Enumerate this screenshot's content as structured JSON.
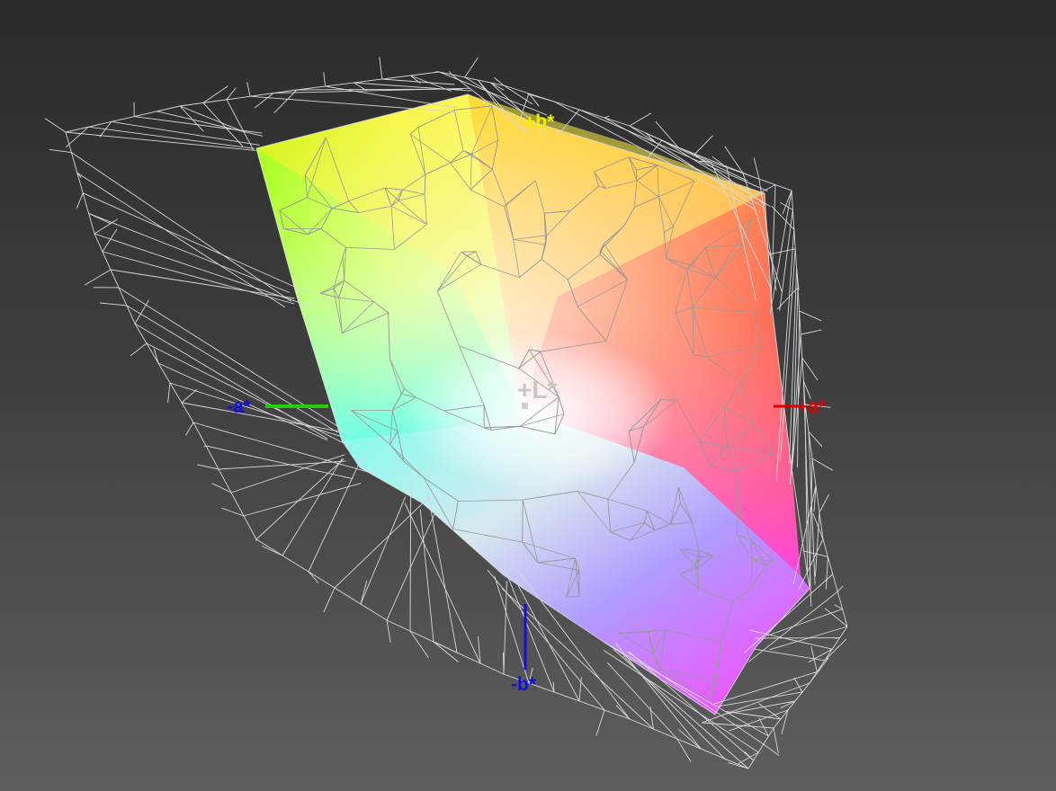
{
  "axes": {
    "plus_l": "+L*",
    "plus_a": "+a*",
    "minus_a": "-a*",
    "plus_b": "+b*",
    "minus_b": "-b*"
  },
  "colors": {
    "background_top": "#2b2b2b",
    "background_bottom": "#5e5e5e",
    "wireframe": "#d8d8d8",
    "mesh_lines": "#9a9a9a",
    "plus_a_axis": "#e00000",
    "minus_a_axis": "#20d000",
    "plus_b_axis": "#f0f000",
    "minus_b_axis": "#1010e0",
    "l_axis": "#cccccc"
  }
}
